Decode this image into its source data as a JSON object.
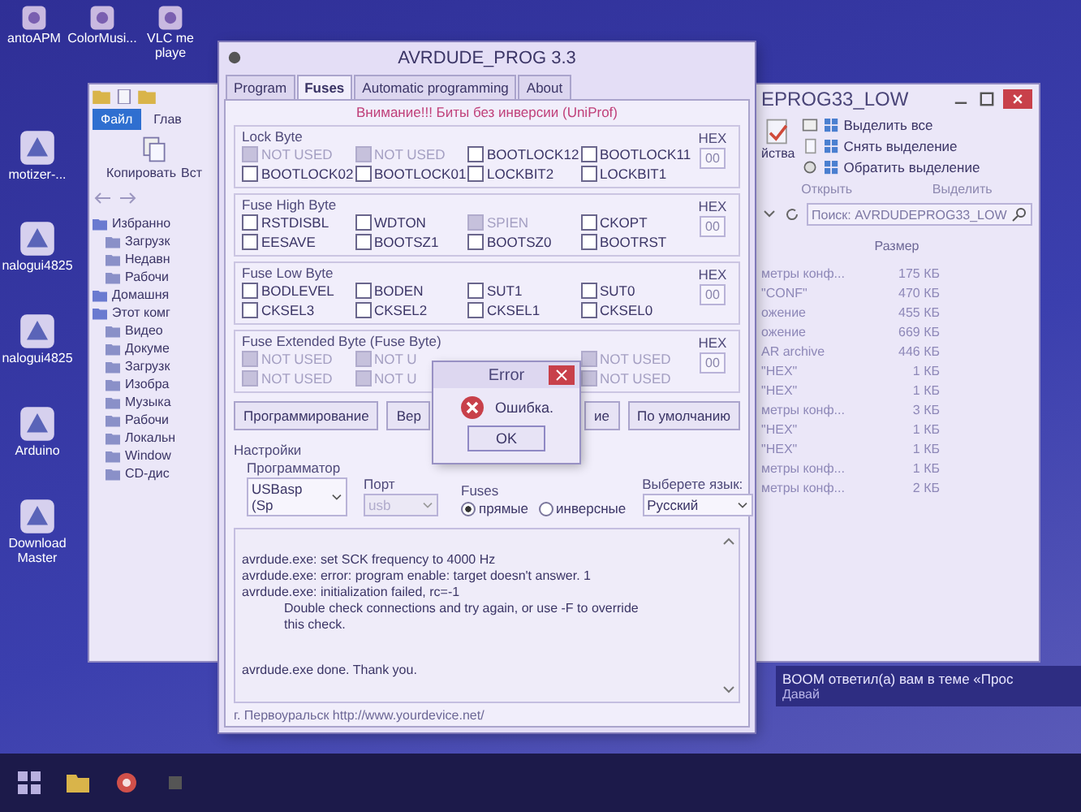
{
  "desktop": {
    "top_icons": [
      {
        "label": "antoAPM"
      },
      {
        "label": "ColorMusi..."
      },
      {
        "label": "VLC me playe"
      }
    ],
    "side_icons": [
      {
        "label": "motizer-..."
      },
      {
        "label": "nalogui4825"
      },
      {
        "label": "nalogui4825"
      },
      {
        "label": "Arduino"
      },
      {
        "label": "Download Master"
      }
    ]
  },
  "explorer": {
    "title": "EPROG33_LOW",
    "ribbon_tabs": [
      {
        "label": "Файл",
        "selected": true
      },
      {
        "label": "Глав",
        "selected": false
      }
    ],
    "clipboard_buttons": [
      "Копировать",
      "Вст"
    ],
    "properties_label": "йства",
    "select_actions": [
      "Выделить все",
      "Снять выделение",
      "Обратить выделение"
    ],
    "group_labels": [
      "Открыть",
      "Выделить"
    ],
    "search": {
      "placeholder": "Поиск: AVRDUDEPROG33_LOW"
    },
    "size_header": "Размер",
    "nav_tree": [
      {
        "label": "Избранно",
        "children": [
          {
            "label": "Загрузк"
          },
          {
            "label": "Недавн"
          },
          {
            "label": "Рабочи"
          }
        ]
      },
      {
        "label": "Домашня"
      },
      {
        "label": "Этот комг",
        "children": [
          {
            "label": "Видео"
          },
          {
            "label": "Докуме"
          },
          {
            "label": "Загрузк"
          },
          {
            "label": "Изобра"
          },
          {
            "label": "Музыка"
          },
          {
            "label": "Рабочи"
          },
          {
            "label": "Локальн"
          },
          {
            "label": "Window"
          },
          {
            "label": "CD-дис"
          }
        ]
      }
    ],
    "files": [
      {
        "type": "метры конф...",
        "size": "175 КБ"
      },
      {
        "type": "\"CONF\"",
        "size": "470 КБ"
      },
      {
        "type": "ожение",
        "size": "455 КБ"
      },
      {
        "type": "ожение",
        "size": "669 КБ"
      },
      {
        "type": "AR archive",
        "size": "446 КБ"
      },
      {
        "type": "\"HEX\"",
        "size": "1 КБ"
      },
      {
        "type": "\"HEX\"",
        "size": "1 КБ"
      },
      {
        "type": "метры конф...",
        "size": "3 КБ"
      },
      {
        "type": "\"HEX\"",
        "size": "1 КБ"
      },
      {
        "type": "\"HEX\"",
        "size": "1 КБ"
      },
      {
        "type": "метры конф...",
        "size": "1 КБ"
      },
      {
        "type": "метры конф...",
        "size": "2 КБ"
      }
    ]
  },
  "avrdude": {
    "title": "AVRDUDE_PROG 3.3",
    "tabs": [
      {
        "label": "Program",
        "selected": false
      },
      {
        "label": "Fuses",
        "selected": true
      },
      {
        "label": "Automatic programming",
        "selected": false
      },
      {
        "label": "About",
        "selected": false
      }
    ],
    "warning": "Внимание!!! Биты без инверсии (UniProf)",
    "fuse_groups": [
      {
        "title": "Lock Byte",
        "hex_label": "HEX",
        "hex": "00",
        "columns": [
          [
            {
              "label": "NOT USED",
              "checked": false,
              "disabled": true
            },
            {
              "label": "BOOTLOCK02",
              "checked": false,
              "disabled": false
            }
          ],
          [
            {
              "label": "NOT USED",
              "checked": false,
              "disabled": true
            },
            {
              "label": "BOOTLOCK01",
              "checked": false,
              "disabled": false
            }
          ],
          [
            {
              "label": "BOOTLOCK12",
              "checked": false,
              "disabled": false
            },
            {
              "label": "LOCKBIT2",
              "checked": false,
              "disabled": false
            }
          ],
          [
            {
              "label": "BOOTLOCK11",
              "checked": false,
              "disabled": false
            },
            {
              "label": "LOCKBIT1",
              "checked": false,
              "disabled": false
            }
          ]
        ]
      },
      {
        "title": "Fuse High Byte",
        "hex_label": "HEX",
        "hex": "00",
        "columns": [
          [
            {
              "label": "RSTDISBL",
              "checked": false,
              "disabled": false
            },
            {
              "label": "EESAVE",
              "checked": false,
              "disabled": false
            }
          ],
          [
            {
              "label": "WDTON",
              "checked": false,
              "disabled": false
            },
            {
              "label": "BOOTSZ1",
              "checked": false,
              "disabled": false
            }
          ],
          [
            {
              "label": "SPIEN",
              "checked": false,
              "disabled": true
            },
            {
              "label": "BOOTSZ0",
              "checked": false,
              "disabled": false
            }
          ],
          [
            {
              "label": "CKOPT",
              "checked": false,
              "disabled": false
            },
            {
              "label": "BOOTRST",
              "checked": false,
              "disabled": false
            }
          ]
        ]
      },
      {
        "title": "Fuse Low Byte",
        "hex_label": "HEX",
        "hex": "00",
        "columns": [
          [
            {
              "label": "BODLEVEL",
              "checked": false,
              "disabled": false
            },
            {
              "label": "CKSEL3",
              "checked": false,
              "disabled": false
            }
          ],
          [
            {
              "label": "BODEN",
              "checked": false,
              "disabled": false
            },
            {
              "label": "CKSEL2",
              "checked": false,
              "disabled": false
            }
          ],
          [
            {
              "label": "SUT1",
              "checked": false,
              "disabled": false
            },
            {
              "label": "CKSEL1",
              "checked": false,
              "disabled": false
            }
          ],
          [
            {
              "label": "SUT0",
              "checked": false,
              "disabled": false
            },
            {
              "label": "CKSEL0",
              "checked": false,
              "disabled": false
            }
          ]
        ]
      },
      {
        "title": "Fuse Extended Byte (Fuse Byte)",
        "hex_label": "HEX",
        "hex": "00",
        "columns": [
          [
            {
              "label": "NOT USED",
              "checked": false,
              "disabled": true
            },
            {
              "label": "NOT USED",
              "checked": false,
              "disabled": true
            }
          ],
          [
            {
              "label": "NOT U",
              "checked": false,
              "disabled": true
            },
            {
              "label": "NOT U",
              "checked": false,
              "disabled": true
            }
          ],
          [],
          [
            {
              "label": "NOT USED",
              "checked": false,
              "disabled": true
            },
            {
              "label": "NOT USED",
              "checked": false,
              "disabled": true
            }
          ]
        ]
      }
    ],
    "buttons": [
      {
        "label": "Программирование"
      },
      {
        "label": "Вер"
      },
      {
        "label": "ие"
      },
      {
        "label": "По умолчанию"
      }
    ],
    "settings": {
      "title": "Настройки",
      "programmer_label": "Программатор",
      "programmer": "USBasp (Sp",
      "port_label": "Порт",
      "port": "usb",
      "port_disabled": true,
      "fuses_label": "Fuses",
      "fuse_modes": [
        {
          "label": "прямые",
          "selected": true
        },
        {
          "label": "инверсные",
          "selected": false
        }
      ],
      "language_label": "Выберете язык:",
      "language": "Русский"
    },
    "log": [
      {
        "kind": "line",
        "text": "avrdude.exe: set SCK frequency to 4000 Hz"
      },
      {
        "kind": "line",
        "text": "avrdude.exe: error: program enable: target doesn't answer. 1"
      },
      {
        "kind": "line",
        "text": "avrdude.exe: initialization failed, rc=-1"
      },
      {
        "kind": "detail",
        "text": "Double check connections and try again, or use -F to override"
      },
      {
        "kind": "detail",
        "text": "this check."
      },
      {
        "kind": "result",
        "text": "avrdude.exe done.  Thank you."
      }
    ],
    "footer": "г. Первоуральск   http://www.yourdevice.net/"
  },
  "error_dialog": {
    "title": "Error",
    "message": "Ошибка.",
    "button": "OK"
  },
  "notification": {
    "text": "BOOM ответил(а) вам в теме «Прос",
    "subtext": "Давай"
  }
}
